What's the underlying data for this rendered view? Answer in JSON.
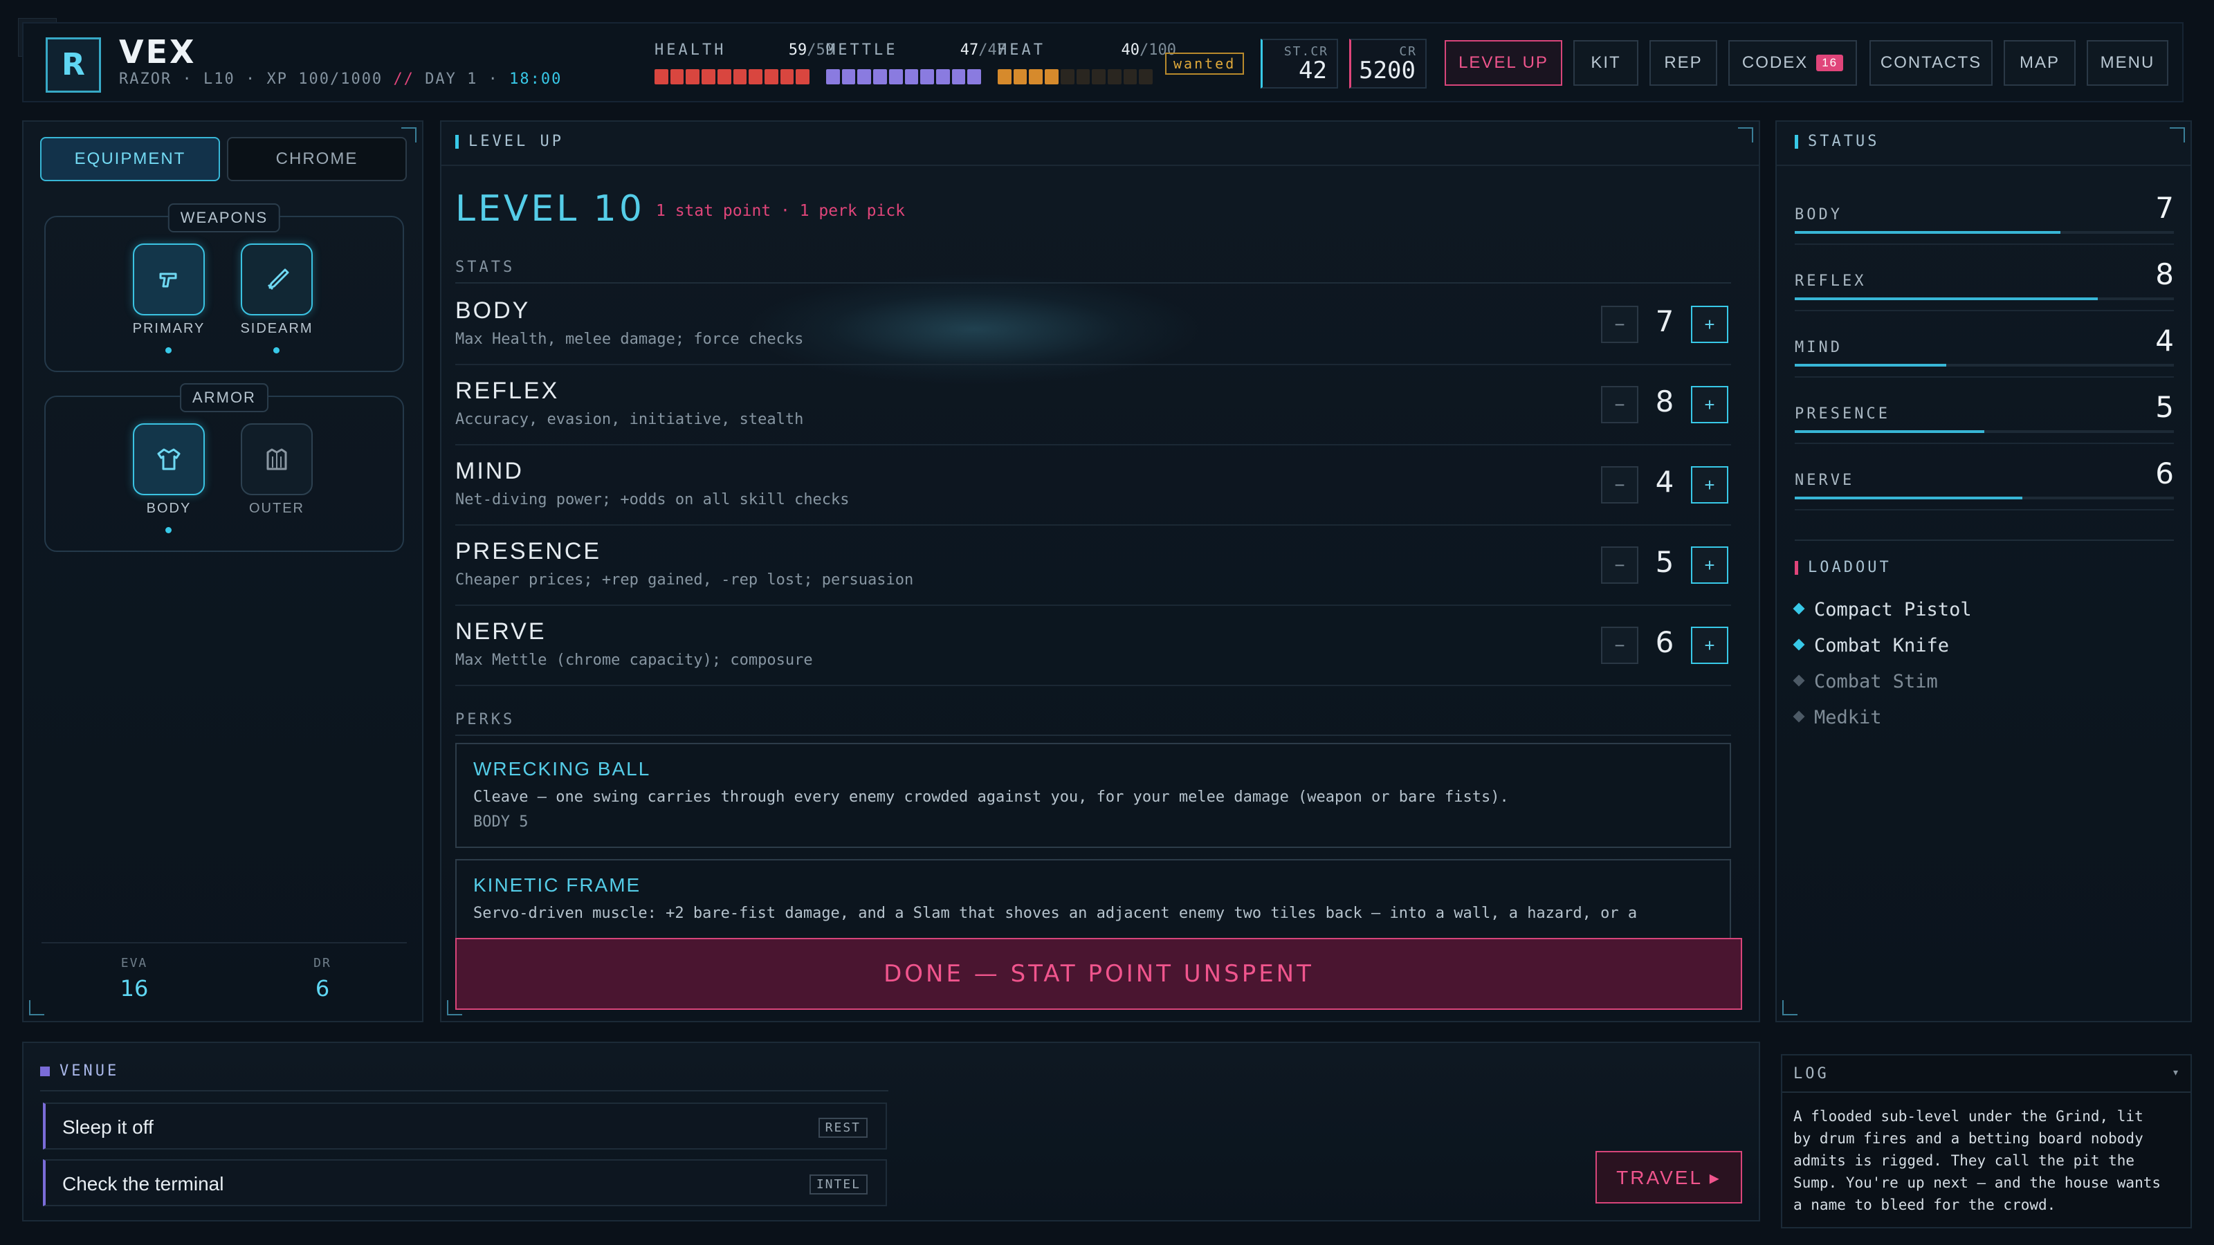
{
  "player": {
    "logo_letter": "R",
    "name": "VEX",
    "class": "RAZOR",
    "level": "L10",
    "xp": "XP 100/1000",
    "separator": "//",
    "day": "DAY 1",
    "time": "18:00"
  },
  "meters": {
    "health": {
      "label": "HEALTH",
      "current": "59",
      "max": "/59",
      "fraction": 1.0,
      "color": "#d9463f"
    },
    "mettle": {
      "label": "METTLE",
      "current": "47",
      "max": "/47",
      "fraction": 1.0,
      "color": "#8a7be0"
    },
    "heat": {
      "label": "HEAT",
      "current": "40",
      "max": "/100",
      "fraction": 0.4,
      "color": "#d68a2c"
    },
    "status_badge": "wanted"
  },
  "credits": {
    "street_label": "ST.CR",
    "street_value": "42",
    "cr_label": "CR",
    "cr_value": "5200"
  },
  "nav": {
    "level_up": "LEVEL UP",
    "kit": "KIT",
    "rep": "REP",
    "codex": "CODEX",
    "codex_count": "16",
    "contacts": "CONTACTS",
    "map": "MAP",
    "menu": "MENU"
  },
  "left": {
    "tabs": {
      "equipment": "EQUIPMENT",
      "chrome": "CHROME"
    },
    "weapons_label": "WEAPONS",
    "primary_label": "PRIMARY",
    "sidearm_label": "SIDEARM",
    "armor_label": "ARMOR",
    "body_label": "BODY",
    "outer_label": "OUTER",
    "eva_label": "EVA",
    "eva_value": "16",
    "dr_label": "DR",
    "dr_value": "6"
  },
  "levelup": {
    "panel_title": "LEVEL UP",
    "heading": "LEVEL 10",
    "points": "1 stat point · 1 perk pick",
    "stats_label": "STATS",
    "stats": [
      {
        "name": "BODY",
        "desc": "Max Health, melee damage; force checks",
        "value": "7"
      },
      {
        "name": "REFLEX",
        "desc": "Accuracy, evasion, initiative, stealth",
        "value": "8"
      },
      {
        "name": "MIND",
        "desc": "Net-diving power; +odds on all skill checks",
        "value": "4"
      },
      {
        "name": "PRESENCE",
        "desc": "Cheaper prices; +rep gained, -rep lost; persuasion",
        "value": "5"
      },
      {
        "name": "NERVE",
        "desc": "Max Mettle (chrome capacity); composure",
        "value": "6"
      }
    ],
    "minus": "−",
    "plus": "+",
    "perks_label": "PERKS",
    "perks": [
      {
        "title": "WRECKING BALL",
        "desc": "Cleave — one swing carries through every enemy crowded against you, for your melee damage (weapon or bare fists).",
        "req": "BODY 5"
      },
      {
        "title": "KINETIC FRAME",
        "desc": "Servo-driven muscle: +2 bare-fist damage, and a Slam that shoves an adjacent enemy two tiles back — into a wall, a hazard, or a"
      }
    ],
    "done_button": "DONE — STAT POINT UNSPENT"
  },
  "status": {
    "title": "STATUS",
    "stats": [
      {
        "name": "BODY",
        "value": "7",
        "fraction": 0.7
      },
      {
        "name": "REFLEX",
        "value": "8",
        "fraction": 0.8
      },
      {
        "name": "MIND",
        "value": "4",
        "fraction": 0.4
      },
      {
        "name": "PRESENCE",
        "value": "5",
        "fraction": 0.5
      },
      {
        "name": "NERVE",
        "value": "6",
        "fraction": 0.6
      }
    ],
    "loadout_title": "LOADOUT",
    "loadout": [
      {
        "name": "Compact Pistol",
        "active": true
      },
      {
        "name": "Combat Knife",
        "active": true
      },
      {
        "name": "Combat Stim",
        "active": false
      },
      {
        "name": "Medkit",
        "active": false
      }
    ]
  },
  "venue": {
    "title": "VENUE",
    "actions": [
      {
        "label": "Sleep it off",
        "tag": "REST"
      },
      {
        "label": "Check the terminal",
        "tag": "INTEL"
      }
    ],
    "travel": "TRAVEL ▸"
  },
  "log": {
    "title": "LOG",
    "toggle": "▾",
    "lines": [
      "A flooded sub-level under the Grind, lit",
      "by drum fires and a betting board nobody",
      "admits is rigged. They call the pit the",
      "Sump. You're up next — and the house wants",
      "a name to bleed for the crowd."
    ]
  },
  "corner_icon": "bug-icon"
}
